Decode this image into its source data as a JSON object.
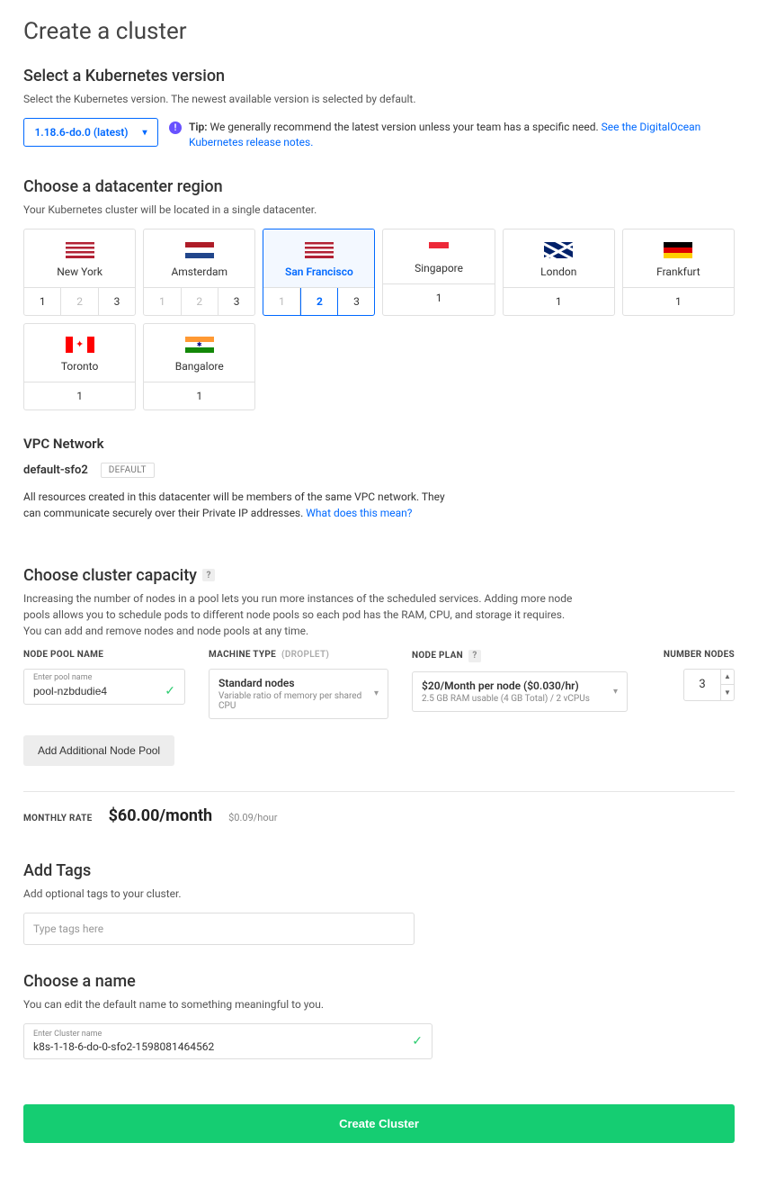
{
  "page_title": "Create a cluster",
  "version_section": {
    "heading": "Select a Kubernetes version",
    "subtext": "Select the Kubernetes version. The newest available version is selected by default.",
    "selected": "1.18.6-do.0 (latest)",
    "tip_label": "Tip:",
    "tip_text": " We generally recommend the latest version unless your team has a specific need. ",
    "tip_link": "See the DigitalOcean Kubernetes release notes."
  },
  "region_section": {
    "heading": "Choose a datacenter region",
    "subtext": "Your Kubernetes cluster will be located in a single datacenter.",
    "regions": [
      {
        "name": "New York",
        "flag": "flag-us",
        "subs": [
          "1",
          "2",
          "3"
        ],
        "disabled": [
          1
        ],
        "selected": false,
        "active": null
      },
      {
        "name": "Amsterdam",
        "flag": "flag-nl",
        "subs": [
          "1",
          "2",
          "3"
        ],
        "disabled": [
          0,
          1
        ],
        "selected": false,
        "active": null
      },
      {
        "name": "San Francisco",
        "flag": "flag-us",
        "subs": [
          "1",
          "2",
          "3"
        ],
        "disabled": [
          0
        ],
        "selected": true,
        "active": 1
      },
      {
        "name": "Singapore",
        "flag": "flag-sg",
        "subs": [
          "1"
        ],
        "disabled": [],
        "selected": false,
        "active": null
      },
      {
        "name": "London",
        "flag": "flag-gb",
        "subs": [
          "1"
        ],
        "disabled": [],
        "selected": false,
        "active": null
      },
      {
        "name": "Frankfurt",
        "flag": "flag-de",
        "subs": [
          "1"
        ],
        "disabled": [],
        "selected": false,
        "active": null
      },
      {
        "name": "Toronto",
        "flag": "flag-ca",
        "subs": [
          "1"
        ],
        "disabled": [],
        "selected": false,
        "active": null
      },
      {
        "name": "Bangalore",
        "flag": "flag-in",
        "subs": [
          "1"
        ],
        "disabled": [],
        "selected": false,
        "active": null
      }
    ]
  },
  "vpc_section": {
    "heading": "VPC Network",
    "name": "default-sfo2",
    "badge": "DEFAULT",
    "desc_pre": "All resources created in this datacenter will be members of the same VPC network. They can communicate securely over their Private IP addresses. ",
    "desc_link": "What does this mean?"
  },
  "capacity_section": {
    "heading": "Choose cluster capacity",
    "subtext": "Increasing the number of nodes in a pool lets you run more instances of the scheduled services. Adding more node pools allows you to schedule pods to different node pools so each pod has the RAM, CPU, and storage it requires. You can add and remove nodes and node pools at any time.",
    "pool_name_label": "NODE POOL NAME",
    "pool_name_placeholder": "Enter pool name",
    "pool_name_value": "pool-nzbdudie4",
    "machine_type_label": "MACHINE TYPE",
    "machine_type_qual": "(DROPLET)",
    "machine_type_main": "Standard nodes",
    "machine_type_sub": "Variable ratio of memory per shared CPU",
    "node_plan_label": "NODE PLAN",
    "node_plan_main": "$20/Month per node ($0.030/hr)",
    "node_plan_sub": "2.5 GB RAM usable (4 GB Total) / 2 vCPUs",
    "number_nodes_label": "NUMBER NODES",
    "number_nodes_value": "3",
    "add_pool_btn": "Add Additional Node Pool"
  },
  "rate_section": {
    "label": "MONTHLY RATE",
    "main": "$60.00/month",
    "sub": "$0.09/hour"
  },
  "tags_section": {
    "heading": "Add Tags",
    "subtext": "Add optional tags to your cluster.",
    "placeholder": "Type tags here"
  },
  "name_section": {
    "heading": "Choose a name",
    "subtext": "You can edit the default name to something meaningful to you.",
    "label": "Enter Cluster name",
    "value": "k8s-1-18-6-do-0-sfo2-1598081464562"
  },
  "submit": "Create Cluster"
}
